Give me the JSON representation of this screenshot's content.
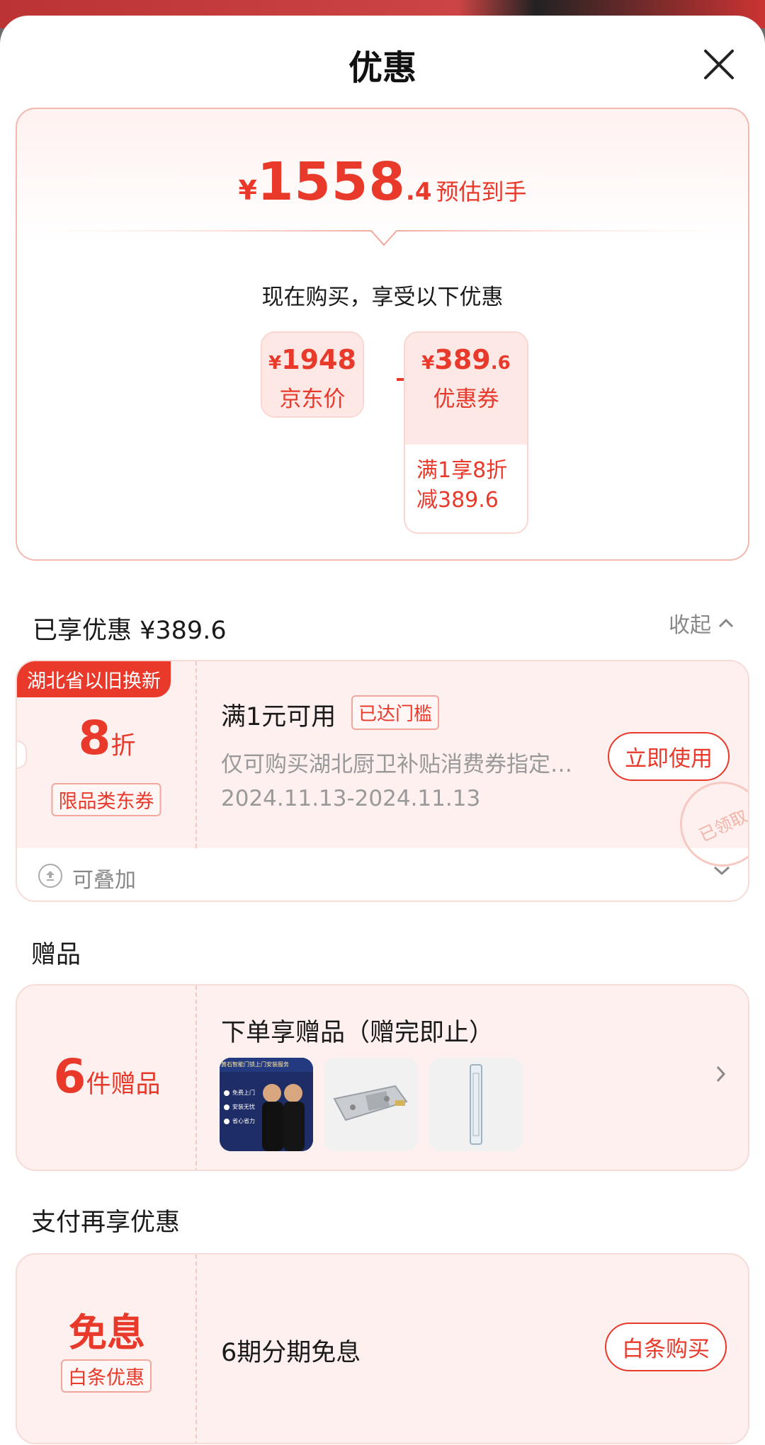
{
  "header": {
    "title": "优惠"
  },
  "summary": {
    "final_yen": "¥",
    "final_int": "1558",
    "final_dec": ".4",
    "final_tag": "预估到手",
    "subtitle": "现在购买，享受以下优惠",
    "jd_price": {
      "yen": "¥",
      "amount": "1948",
      "label": "京东价"
    },
    "coupon_price": {
      "yen": "¥",
      "amount": "389",
      "dec": ".6",
      "label": "优惠券",
      "detail_line1": "满1享8折",
      "detail_line2": "减389.6"
    }
  },
  "enjoyed": {
    "title": "已享优惠 ¥389.6",
    "collapse_label": "收起"
  },
  "coupon": {
    "ribbon": "湖北省以旧换新",
    "discount": "8",
    "discount_unit": "折",
    "type_tag": "限品类东券",
    "title": "满1元可用",
    "threshold_tag": "已达门槛",
    "description": "仅可购买湖北厨卫补贴消费券指定商品",
    "date_range": "2024.11.13-2024.11.13",
    "use_button": "立即使用",
    "stamp": "已领取",
    "stack_label": "可叠加"
  },
  "gifts": {
    "section_title": "赠品",
    "count": "6",
    "count_unit": "件赠品",
    "title": "下单享赠品（赠完即止）",
    "thumb1_heading": "黄石智能门锁上门安装服务",
    "thumb1_items": [
      "免费上门",
      "安装无忧",
      "省心省力"
    ]
  },
  "payment": {
    "section_title": "支付再享优惠",
    "badge": "免息",
    "badge_tag": "白条优惠",
    "title": "6期分期免息",
    "button": "白条购买"
  },
  "colors": {
    "accent": "#e8392b",
    "card_bg": "#fef0ee",
    "border": "#f6dcd7"
  }
}
